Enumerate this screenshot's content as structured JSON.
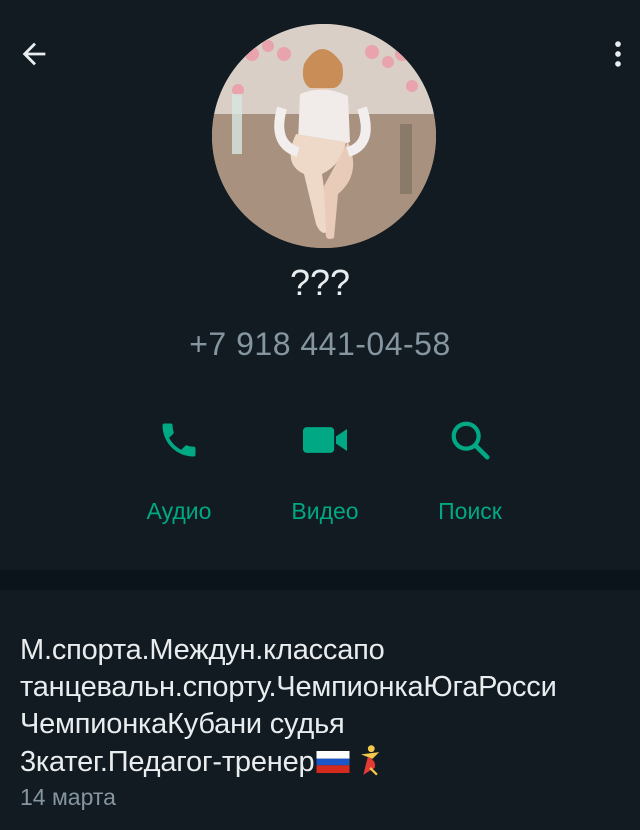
{
  "header": {
    "back_icon": "arrow-left-icon",
    "menu_icon": "more-vertical-icon"
  },
  "contact": {
    "name": "???",
    "phone": "+7 918 441-04-58"
  },
  "actions": [
    {
      "label": "Аудио",
      "icon": "phone-icon"
    },
    {
      "label": "Видео",
      "icon": "video-camera-icon"
    },
    {
      "label": "Поиск",
      "icon": "search-icon"
    }
  ],
  "about": {
    "text": "М.спорта.Междун.классапо\nтанцевальн.спорту.ЧемпионкаЮгаРосси\nЧемпионкаКубани судья\n3катег.Педагог-тренер",
    "date": "14 марта",
    "emojis": [
      "russia-flag-icon",
      "dancer-icon"
    ]
  },
  "colors": {
    "accent": "#00a884",
    "background": "#0b141a",
    "panel": "#111b21",
    "secondary_text": "#8696a0"
  }
}
